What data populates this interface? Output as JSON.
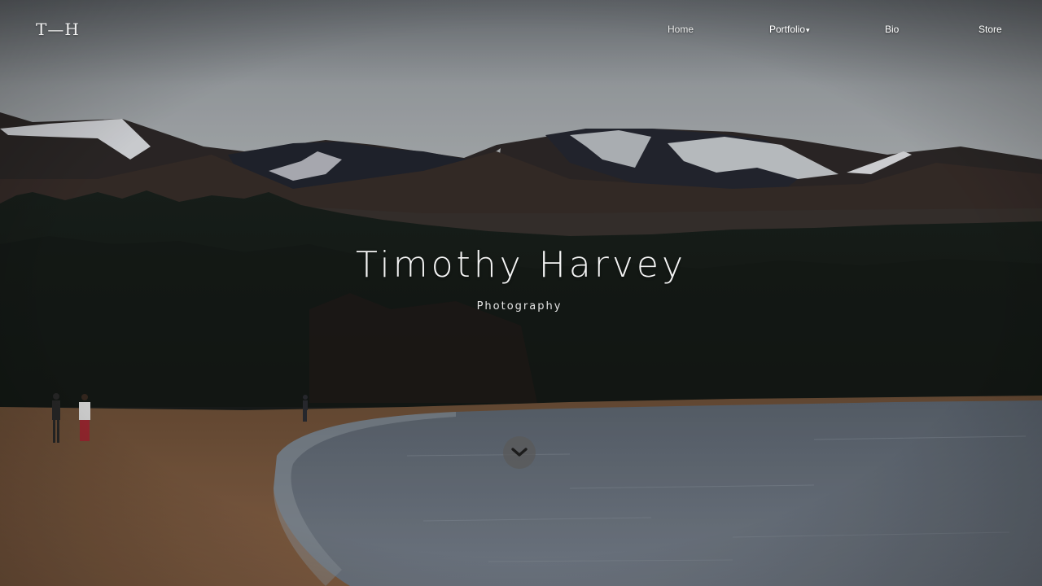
{
  "brand": {
    "logo_text": "T—H"
  },
  "nav": {
    "items": [
      {
        "label": "Home"
      },
      {
        "label": "Portfolio",
        "has_dropdown": true
      },
      {
        "label": "Bio"
      },
      {
        "label": "Store"
      }
    ],
    "dropdown_caret": "▾"
  },
  "hero": {
    "title": "Timothy Harvey",
    "subtitle": "Photography",
    "scroll_icon": "chevron-down-icon"
  },
  "colors": {
    "sky": "#b7bcc0",
    "forest": "#1c231f",
    "sand": "#8a6446",
    "water": "#6f7884",
    "text": "#f4f4f4"
  }
}
